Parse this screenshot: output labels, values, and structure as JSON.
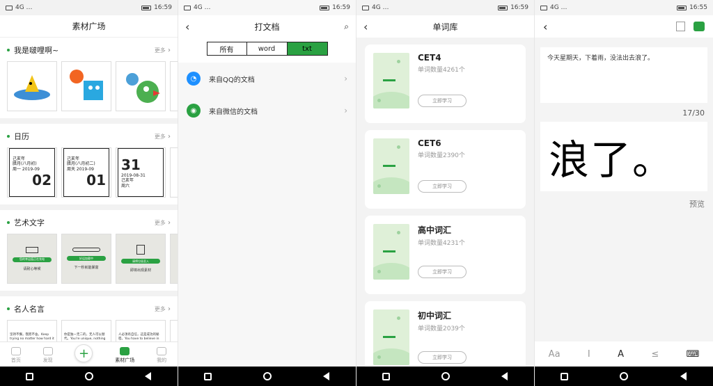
{
  "status": [
    {
      "left": "4G  …",
      "time": "16:59"
    },
    {
      "left": "4G  …",
      "time": "16:59"
    },
    {
      "left": "4G  …",
      "time": "16:59"
    },
    {
      "left": "4G  …",
      "time": "16:55"
    }
  ],
  "screen1": {
    "title": "素材广场",
    "sections": [
      {
        "title": "我是啵哩啊~",
        "more": "更多"
      },
      {
        "title": "日历",
        "more": "更多"
      },
      {
        "title": "艺术文字",
        "more": "更多"
      },
      {
        "title": "名人名言",
        "more": "更多"
      }
    ],
    "calendar": [
      {
        "lines": [
          "己亥年",
          "腊月(八月初)",
          "周一  2019-09"
        ],
        "day": "02"
      },
      {
        "lines": [
          "己亥年",
          "腊月(八月初二)",
          "周天  2019-09"
        ],
        "day": "01"
      },
      {
        "lines": [
          "2019-08-31",
          "己亥年",
          "周六"
        ],
        "day": "31"
      }
    ],
    "art": [
      {
        "bar": "您的幸运值正在充电",
        "cap": "请耐心等候"
      },
      {
        "bar": "好运加载中",
        "cap": "下一秒就能暴富"
      },
      {
        "bar": "请将垃圾丢入",
        "cap": "即将出现素材"
      }
    ],
    "quotes": [
      "坚持不懈，锲而不舍。Keep trying no matter how hard it seems. It will get easier.",
      "你是独一无二的，无人可以替代。You're unique, nothing can replace you.",
      "人必须有自信，这是成功的秘密。You have to believe in yourself. That's the secret of success."
    ],
    "tabs": [
      {
        "label": "首页",
        "active": false
      },
      {
        "label": "发现",
        "active": false
      },
      {
        "label": "+",
        "active": false
      },
      {
        "label": "素材广场",
        "active": true
      },
      {
        "label": "我的",
        "active": false
      }
    ]
  },
  "screen2": {
    "title": "打文档",
    "segments": [
      "所有",
      "word",
      "txt"
    ],
    "active_segment": "txt",
    "rows": [
      {
        "label": "来自QQ的文档",
        "icon": "qq-icon",
        "color": "#1e90ff"
      },
      {
        "label": "来自微信的文档",
        "icon": "wechat-icon",
        "color": "#2aa142"
      }
    ]
  },
  "screen3": {
    "title": "单词库",
    "button_label": "立即学习",
    "cards": [
      {
        "name": "CET4",
        "count": "单词数量4261个"
      },
      {
        "name": "CET6",
        "count": "单词数量2390个"
      },
      {
        "name": "高中词汇",
        "count": "单词数量4231个"
      },
      {
        "name": "初中词汇",
        "count": "单词数量2039个"
      }
    ]
  },
  "screen4": {
    "text": "今天星期天，下着雨，没法出去浪了。",
    "counter": "17/30",
    "preview_text": "浪了。",
    "preview_label": "预览",
    "toolbar": [
      "Aa",
      "I",
      "A",
      "≤",
      "⌨"
    ]
  },
  "colors": {
    "accent": "#2aa142"
  }
}
